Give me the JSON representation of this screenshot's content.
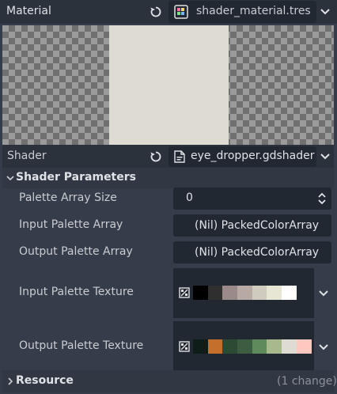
{
  "header": {
    "label": "Material",
    "resource_name": "shader_material.tres"
  },
  "preview": {
    "color": "#dedbd2"
  },
  "shader": {
    "label": "Shader",
    "file_name": "eye_dropper.gdshader"
  },
  "shader_parameters": {
    "title": "Shader Parameters",
    "params": [
      {
        "label": "Palette Array Size",
        "value": "0"
      },
      {
        "label": "Input Palette Array",
        "value": "(Nil) PackedColorArray"
      },
      {
        "label": "Output Palette Array",
        "value": "(Nil) PackedColorArray"
      },
      {
        "label": "Input Palette Texture",
        "colors": [
          "#000000",
          "#2f2f2f",
          "#9a8b8a",
          "#b7a9a4",
          "#cfcbbe",
          "#e7e6d5",
          "#ffffff"
        ]
      },
      {
        "label": "Output Palette Texture",
        "colors": [
          "#0e1d18",
          "#c46f2b",
          "#2d4a35",
          "#3d5d42",
          "#5f8a5c",
          "#a8b98e",
          "#dedbd2",
          "#ffc7bd"
        ]
      }
    ]
  },
  "resource": {
    "title": "Resource",
    "changes": "(1 change)"
  },
  "colors": {
    "panel_bg": "#363d4a",
    "field_bg": "#222831",
    "header_bg": "#2c323c"
  }
}
